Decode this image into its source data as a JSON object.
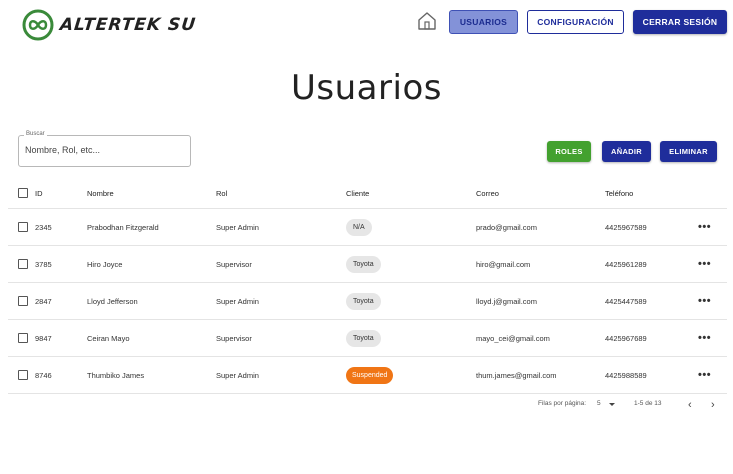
{
  "header": {
    "logo_text": "ALTERTEK SU",
    "nav": {
      "usuarios": "USUARIOS",
      "configuracion": "CONFIGURACIÓN",
      "cerrar": "CERRAR SESIÓN"
    },
    "colors": {
      "primary": "#1f2d9b",
      "active": "#8392d8",
      "logo_green": "#3a8a3a"
    }
  },
  "page": {
    "title": "Usuarios"
  },
  "search": {
    "label": "Buscar",
    "placeholder": "Nombre, Rol, etc..."
  },
  "actions": {
    "roles": "ROLES",
    "anadir": "AÑADIR",
    "eliminar": "ELIMINAR",
    "colors": {
      "roles": "#43a12f",
      "anadir": "#1f2d9b",
      "eliminar": "#1f2d9b"
    }
  },
  "table": {
    "columns": {
      "id": "ID",
      "nombre": "Nombre",
      "rol": "Rol",
      "cliente": "Cliente",
      "correo": "Correo",
      "telefono": "Teléfono"
    },
    "more_glyph": "•••",
    "rows": [
      {
        "id": "2345",
        "nombre": "Prabodhan Fitzgerald",
        "rol": "Super Admin",
        "cliente": "N/A",
        "correo": "prado@gmail.com",
        "telefono": "4425967589"
      },
      {
        "id": "3785",
        "nombre": "Hiro Joyce",
        "rol": "Supervisor",
        "cliente": "Toyota",
        "correo": "hiro@gmail.com",
        "telefono": "4425961289"
      },
      {
        "id": "2847",
        "nombre": "Lloyd Jefferson",
        "rol": "Super Admin",
        "cliente": "Toyota",
        "correo": "lloyd.j@gmail.com",
        "telefono": "4425447589"
      },
      {
        "id": "9847",
        "nombre": "Ceiran Mayo",
        "rol": "Supervisor",
        "cliente": "Toyota",
        "correo": "mayo_cei@gmail.com",
        "telefono": "4425967689"
      },
      {
        "id": "8746",
        "nombre": "Thumbiko James",
        "rol": "Super Admin",
        "cliente": "Suspended",
        "correo": "thum.james@gmail.com",
        "telefono": "4425988589"
      }
    ]
  },
  "pagination": {
    "rows_label": "Filas por página:",
    "rows_value": "5",
    "range": "1-5 de 13",
    "prev": "‹",
    "next": "›"
  }
}
